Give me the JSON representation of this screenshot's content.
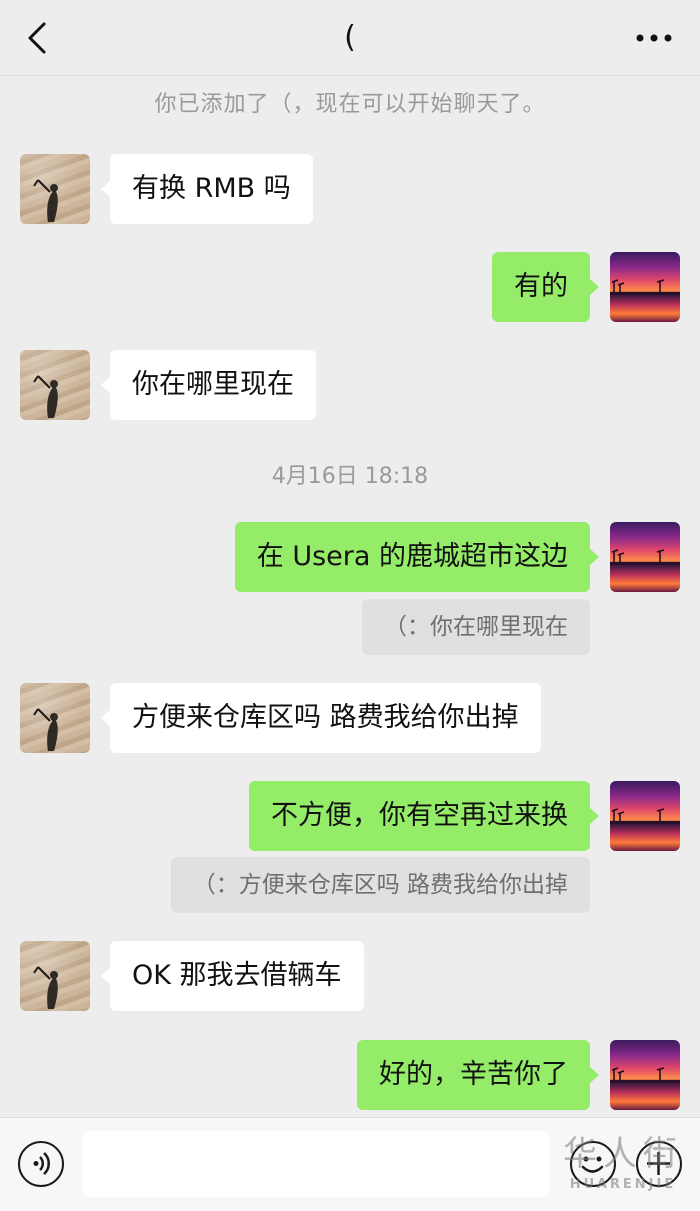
{
  "header": {
    "title": "(",
    "back_icon": "chevron-left-icon",
    "more_icon": "more-dots-icon"
  },
  "system_note": "你已添加了（，现在可以开始聊天了。",
  "timestamp": "4月16日 18:18",
  "messages": [
    {
      "side": "in",
      "text": "有换 RMB 吗"
    },
    {
      "side": "out",
      "text": "有的"
    },
    {
      "side": "in",
      "text": "你在哪里现在"
    },
    {
      "side": "out",
      "text": "在 Usera 的鹿城超市这边",
      "quote": "（：你在哪里现在"
    },
    {
      "side": "in",
      "text": "方便来仓库区吗 路费我给你出掉"
    },
    {
      "side": "out",
      "text": "不方便，你有空再过来换",
      "quote": "（：方便来仓库区吗 路费我给你出掉"
    },
    {
      "side": "in",
      "text": "OK 那我去借辆车"
    },
    {
      "side": "out",
      "text": "好的，辛苦你了"
    }
  ],
  "input_bar": {
    "voice_icon": "voice-icon",
    "emoji_icon": "emoji-icon",
    "plus_icon": "plus-icon",
    "text_value": ""
  },
  "watermark": {
    "cn": "华人街",
    "en": "HUARENJIE"
  },
  "colors": {
    "background": "#ededed",
    "incoming_bubble": "#ffffff",
    "outgoing_bubble": "#95ec69",
    "quote_bg": "#e0e0e0",
    "meta_text": "#9a9a9a"
  }
}
